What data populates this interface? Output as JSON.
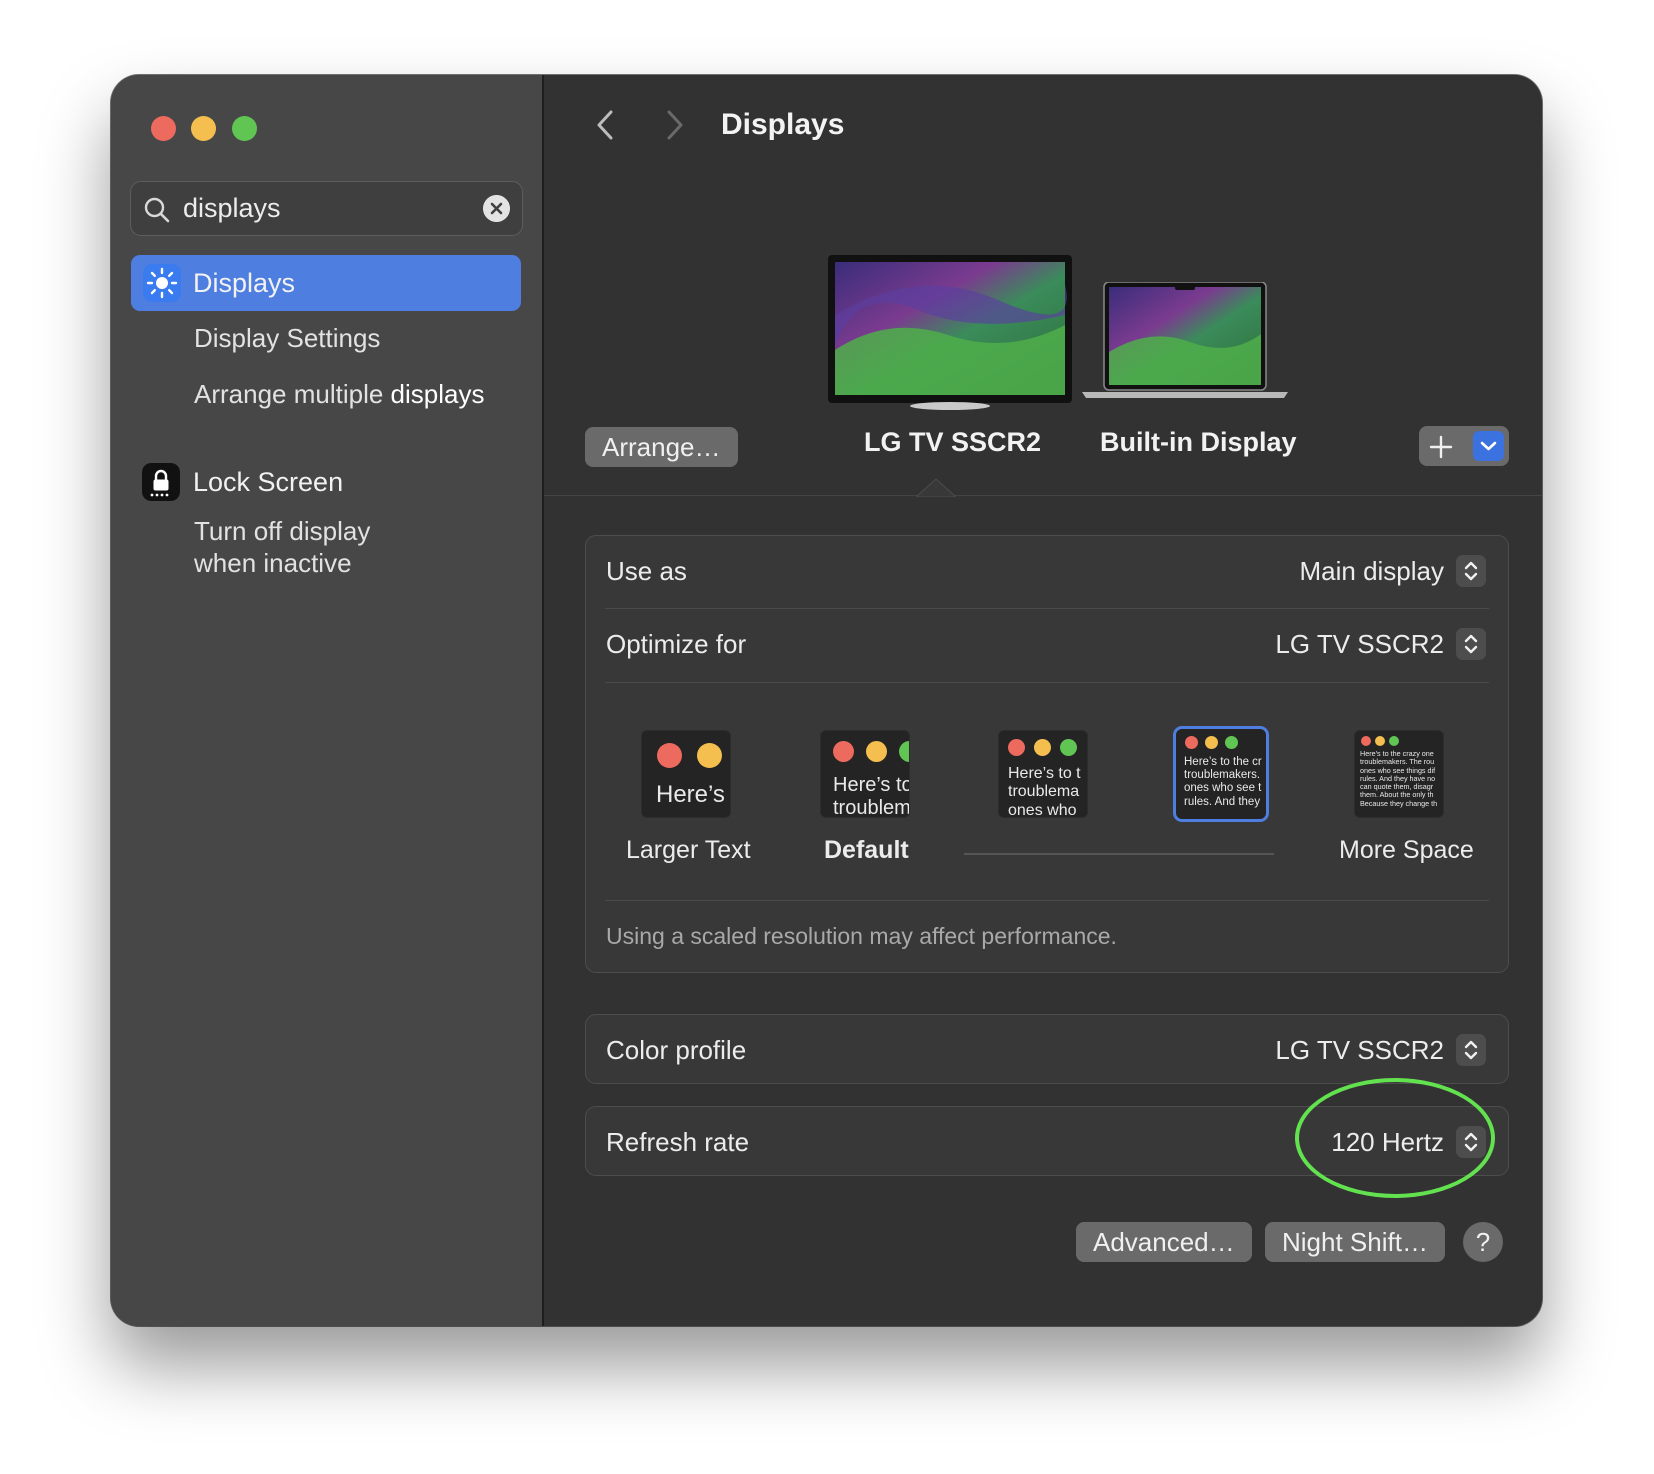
{
  "search": {
    "value": "displays"
  },
  "sidebar": {
    "items": [
      {
        "label": "Displays"
      },
      {
        "label": "Display Settings"
      },
      {
        "label_prefix": "Arrange multiple ",
        "label_highlight": "displays"
      },
      {
        "label": "Lock Screen"
      },
      {
        "label_line1": "Turn off display",
        "label_line2": "when inactive"
      }
    ]
  },
  "header": {
    "title": "Displays"
  },
  "displays": {
    "arrange_label": "Arrange…",
    "items": [
      {
        "name": "LG TV SSCR2"
      },
      {
        "name": "Built-in Display"
      }
    ]
  },
  "settings": {
    "use_as": {
      "label": "Use as",
      "value": "Main display"
    },
    "optimize_for": {
      "label": "Optimize for",
      "value": "LG TV SSCR2"
    },
    "resolution_options": [
      {
        "label": "Larger Text",
        "preview": "Here’s"
      },
      {
        "label": "Default",
        "preview": "Here’s to\ntroublem"
      },
      {
        "label": "",
        "preview": "Here’s to t\ntroublema\nones who"
      },
      {
        "label": "",
        "preview": "Here’s to the cr\ntroublemakers.\nones who see t\nrules. And they"
      },
      {
        "label": "More Space",
        "preview": "Here’s to the crazy one\ntroublemakers. The rou\nones who see things dif\nrules. And they have no\ncan quote them, disagr\nthem. About the only th\nBecause they change th"
      }
    ],
    "selected_resolution_index": 3,
    "note": "Using a scaled resolution may affect performance.",
    "color_profile": {
      "label": "Color profile",
      "value": "LG TV SSCR2"
    },
    "refresh_rate": {
      "label": "Refresh rate",
      "value": "120 Hertz"
    }
  },
  "footer": {
    "advanced_label": "Advanced…",
    "night_shift_label": "Night Shift…",
    "help_label": "?"
  },
  "colors": {
    "accent": "#4e7ee0",
    "highlight_ring": "#63e24f"
  }
}
